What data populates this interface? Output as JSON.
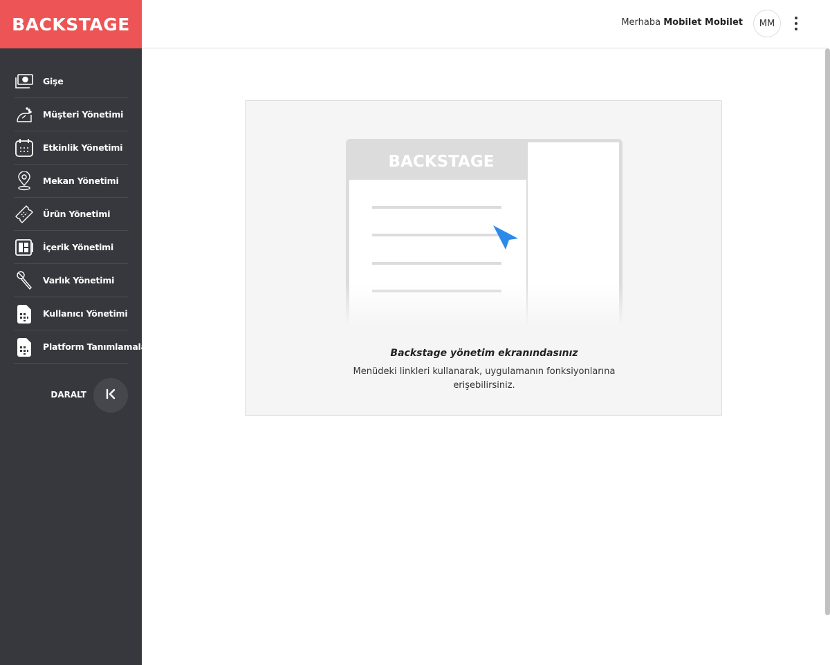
{
  "brand": {
    "logo_text": "BACKSTAGE",
    "color": "#ed5455"
  },
  "header": {
    "greeting": "Merhaba",
    "user_name": "Mobilet Mobilet",
    "avatar_initials": "MM"
  },
  "sidebar": {
    "items": [
      {
        "label": "Gişe",
        "icon": "cash-register-icon"
      },
      {
        "label": "Müşteri Yönetimi",
        "icon": "customer-icon"
      },
      {
        "label": "Etkinlik Yönetimi",
        "icon": "calendar-icon"
      },
      {
        "label": "Mekan Yönetimi",
        "icon": "map-pin-icon"
      },
      {
        "label": "Ürün Yönetimi",
        "icon": "ticket-icon"
      },
      {
        "label": "İçerik Yönetimi",
        "icon": "content-grid-icon"
      },
      {
        "label": "Varlık Yönetimi",
        "icon": "microphone-icon"
      },
      {
        "label": "Kullanıcı Yönetimi",
        "icon": "sim-card-icon"
      },
      {
        "label": "Platform Tanımlamaları",
        "icon": "sim-card-icon"
      }
    ],
    "collapse_label": "DARALT"
  },
  "welcome": {
    "illustration_logo": "BACKSTAGE",
    "title": "Backstage yönetim ekranındasınız",
    "text": "Menüdeki linkleri kullanarak, uygulamanın fonksiyonlarına erişebilirsiniz."
  },
  "colors": {
    "sidebar_bg": "#36383d",
    "accent_blue": "#2d8ae8"
  }
}
